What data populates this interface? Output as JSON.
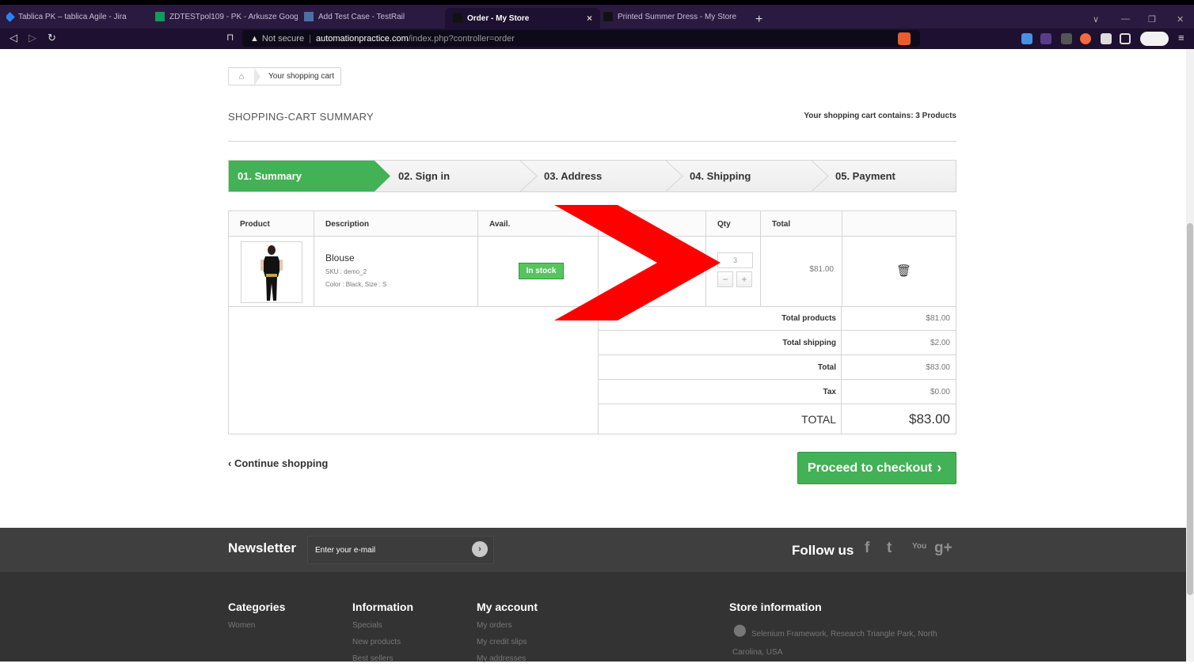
{
  "browser": {
    "tabs": [
      {
        "label": "Tablica PK – tablica Agile - Jira",
        "icon": "jira-icon",
        "color": "#2684ff"
      },
      {
        "label": "ZDTESTpol109 - PK - Arkusze Google",
        "icon": "sheets-icon",
        "color": "#0f9d58"
      },
      {
        "label": "Add Test Case - TestRail",
        "icon": "testrail-icon",
        "color": "#4a6fa5"
      },
      {
        "label": "Order - My Store",
        "icon": "store-icon",
        "color": "#222222"
      },
      {
        "label": "Printed Summer Dress - My Store",
        "icon": "store-icon",
        "color": "#222222"
      }
    ],
    "active_tab_close": "×",
    "new_tab": "+",
    "address": {
      "warning": "Not secure",
      "host": "automationpractice.com",
      "path": "/index.php?controller=order"
    }
  },
  "breadcrumb": {
    "current": "Your shopping cart"
  },
  "heading": "SHOPPING-CART SUMMARY",
  "cart_count": "Your shopping cart contains: 3 Products",
  "steps": [
    {
      "label": "01. Summary"
    },
    {
      "label": "02. Sign in"
    },
    {
      "label": "03. Address"
    },
    {
      "label": "04. Shipping"
    },
    {
      "label": "05. Payment"
    }
  ],
  "table": {
    "headers": [
      "Product",
      "Description",
      "Avail.",
      "",
      "Qty",
      "Total",
      ""
    ],
    "item": {
      "name": "Blouse",
      "sku": "SKU : demo_2",
      "attributes": "Color : Black, Size : S",
      "availability": "In stock",
      "qty": "3",
      "total": "$81.00"
    },
    "totals": [
      {
        "label": "Total products",
        "value": "$81.00"
      },
      {
        "label": "Total shipping",
        "value": "$2.00"
      },
      {
        "label": "Total",
        "value": "$83.00"
      },
      {
        "label": "Tax",
        "value": "$0.00"
      },
      {
        "label": "TOTAL",
        "value": "$83.00"
      }
    ]
  },
  "actions": {
    "continue": "Continue shopping",
    "checkout": "Proceed to checkout"
  },
  "newsletter": {
    "title": "Newsletter",
    "placeholder": "Enter your e-mail",
    "follow": "Follow us",
    "social_labels": [
      "f",
      "t",
      "You",
      "g+"
    ]
  },
  "footer": {
    "categories": {
      "title": "Categories",
      "links": [
        "Women"
      ]
    },
    "information": {
      "title": "Information",
      "links": [
        "Specials",
        "New products",
        "Best sellers"
      ]
    },
    "account": {
      "title": "My account",
      "links": [
        "My orders",
        "My credit slips",
        "My addresses"
      ]
    },
    "store": {
      "title": "Store information",
      "address": "Selenium Framework, Research Triangle Park, North Carolina, USA"
    }
  },
  "colors": {
    "accent_green": "#43b155",
    "annotation_red": "#ff0000",
    "browser_bg": "#1e1030"
  }
}
